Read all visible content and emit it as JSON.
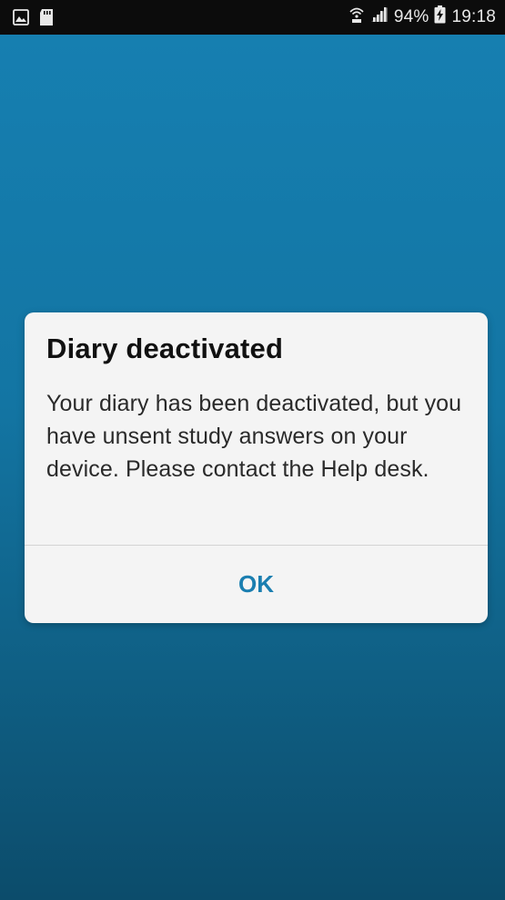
{
  "status_bar": {
    "icons_left": [
      "image-icon",
      "sd-card-icon"
    ],
    "icons_right": [
      "wifi-calling-icon",
      "signal-icon",
      "battery-charging-icon"
    ],
    "battery": "94%",
    "time": "19:18"
  },
  "dialog": {
    "title": "Diary deactivated",
    "message": "Your diary has been deactivated, but you have unsent study answers on your device. Please contact the Help desk.",
    "ok_label": "OK"
  },
  "colors": {
    "background_top": "#1680b2",
    "background_bottom": "#0c4c6b",
    "accent": "#1a7eb0",
    "dialog_bg": "#f4f4f4"
  }
}
